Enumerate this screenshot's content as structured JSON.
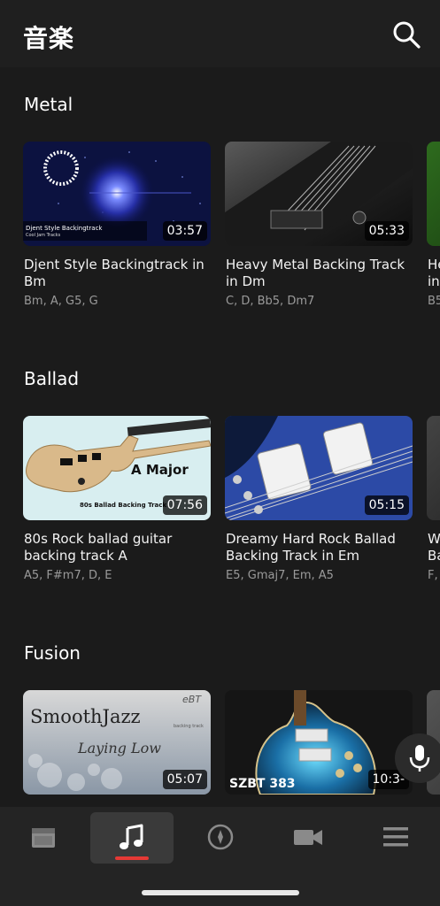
{
  "header": {
    "title": "音楽"
  },
  "sections": [
    {
      "title": "Metal",
      "cards": [
        {
          "title": "Djent Style Backingtrack in Bm",
          "chords": "Bm, A, G5, G",
          "duration": "03:57",
          "thumb_caption": "Djent Style Backingtrack",
          "thumb_subcaption": "Cool Jam Tracks",
          "ring_text": "Music Backingtrack Studio"
        },
        {
          "title": "Heavy Metal Backing Track in Dm",
          "chords": "C, D, Bb5, Dm7",
          "duration": "05:33"
        },
        {
          "title": "He\nin",
          "chords": "B5"
        }
      ]
    },
    {
      "title": "Ballad",
      "cards": [
        {
          "title": "80s Rock ballad guitar backing track A",
          "chords": "A5, F#m7, D, E",
          "duration": "07:56",
          "thumb_caption": "A Major",
          "thumb_subcaption": "80s Ballad Backing Track"
        },
        {
          "title": "Dreamy Hard Rock Ballad Backing Track in Em",
          "chords": "E5, Gmaj7, Em, A5",
          "duration": "05:15"
        },
        {
          "title": "W\nBa",
          "chords": "F,"
        }
      ]
    },
    {
      "title": "Fusion",
      "cards": [
        {
          "title": "",
          "chords": "",
          "duration": "05:07",
          "thumb_caption": "SmoothJazz",
          "thumb_subcaption": "Laying Low",
          "thumb_badge": "eBT",
          "thumb_badge_sub": "backing track"
        },
        {
          "title": "",
          "chords": "",
          "duration": "10:3-",
          "thumb_caption": "SZBT 383"
        }
      ]
    }
  ],
  "tabbar": {
    "tabs": [
      {
        "icon": "amp-icon",
        "active": false
      },
      {
        "icon": "music-note-icon",
        "active": true
      },
      {
        "icon": "compass-icon",
        "active": false
      },
      {
        "icon": "video-camera-icon",
        "active": false
      },
      {
        "icon": "menu-icon",
        "active": false
      }
    ]
  },
  "colors": {
    "background": "#1b1b1b",
    "accent": "#e53935",
    "muted_text": "#9a9a9a"
  }
}
